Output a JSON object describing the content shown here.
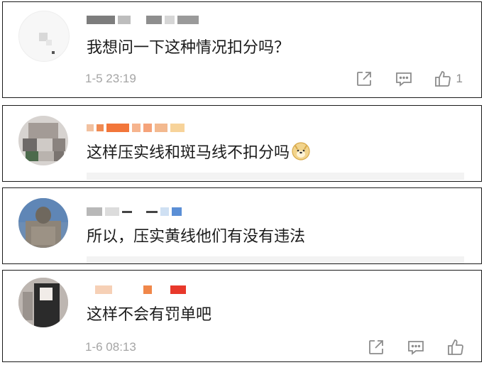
{
  "comments": [
    {
      "text": "我想问一下这种情况扣分吗？",
      "time": "1-5 23:19",
      "like_count": "1",
      "has_actions": true
    },
    {
      "text": "这样压实线和斑马线不扣分吗",
      "emoji": "doge-emoji",
      "time": "",
      "has_actions": false
    },
    {
      "text": "所以，压实黄线他们有没有违法",
      "time": "",
      "has_actions": false
    },
    {
      "text": "这样不会有罚单吧",
      "time": "1-6 08:13",
      "like_count": "",
      "has_actions": true
    }
  ],
  "icons": {
    "share": "share-icon",
    "reply": "comment-icon",
    "like": "thumbs-up-icon"
  },
  "colors": {
    "border": "#1a1a1a",
    "meta_text": "#a5a5a5",
    "icon": "#8c8c8c"
  }
}
